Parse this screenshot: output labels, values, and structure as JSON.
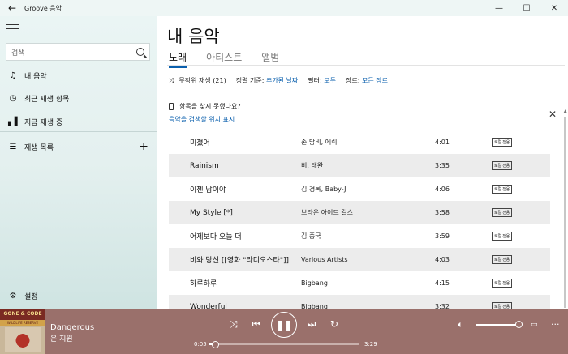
{
  "window": {
    "title": "Groove 음악",
    "back_icon": "back-arrow-icon",
    "minimize": "—",
    "maximize": "☐",
    "close": "✕"
  },
  "sidebar": {
    "search_placeholder": "검색",
    "items": [
      {
        "label": "내 음악",
        "icon": "music-note-icon"
      },
      {
        "label": "최근 재생 항목",
        "icon": "clock-icon"
      },
      {
        "label": "지금 재생 중",
        "icon": "equalizer-icon"
      },
      {
        "label": "재생 목록",
        "icon": "playlist-icon"
      }
    ],
    "settings_label": "설정"
  },
  "main": {
    "title": "내 음악",
    "tabs": [
      "노래",
      "아티스트",
      "앨범"
    ],
    "toolbar": {
      "shuffle_label": "무작위 재생 (21)",
      "sort_label": "정렬 기준:",
      "sort_value": "추가된 날짜",
      "filter_label": "필터:",
      "filter_value": "모두",
      "genre_label": "장르:",
      "genre_value": "모든 장르"
    },
    "notice": {
      "text": "항목을 찾지 못했나요?",
      "link": "음악을 검색할 위치 표시"
    },
    "badge_text": "로컬 전용",
    "songs": [
      {
        "title": "미쳤어",
        "artist": "손 담비, 에릭",
        "duration": "4:01"
      },
      {
        "title": "Rainism",
        "artist": "비, 태완",
        "duration": "3:35"
      },
      {
        "title": "이젠 남이야",
        "artist": "김 경록, Baby-J",
        "duration": "4:06"
      },
      {
        "title": "My Style [*]",
        "artist": "브라운 아이드 걸스",
        "duration": "3:58"
      },
      {
        "title": "어제보다 오늘 더",
        "artist": "김 종국",
        "duration": "3:59"
      },
      {
        "title": "비와 당신 [[영화 \"라디오스타\"]]",
        "artist": "Various Artists",
        "duration": "4:03"
      },
      {
        "title": "하루하루",
        "artist": "Bigbang",
        "duration": "4:15"
      },
      {
        "title": "Wonderful",
        "artist": "Bigbang",
        "duration": "3:32"
      }
    ]
  },
  "player": {
    "album_art_text": "GONE & CODE",
    "album_art_subtext": "WILDLIFE RESERVE",
    "now_playing_title": "Dangerous",
    "now_playing_artist": "은 지원",
    "elapsed": "0:05",
    "total": "3:29",
    "progress_fraction": 0.04,
    "volume_fraction": 1.0,
    "shuffle_icon": "shuffle-icon",
    "prev_icon": "previous-icon",
    "play_pause_icon": "pause-icon",
    "next_icon": "next-icon",
    "repeat_icon": "repeat-icon",
    "volume_icon": "speaker-icon",
    "miniplayer_icon": "miniplayer-icon",
    "more_icon": "more-icon"
  }
}
